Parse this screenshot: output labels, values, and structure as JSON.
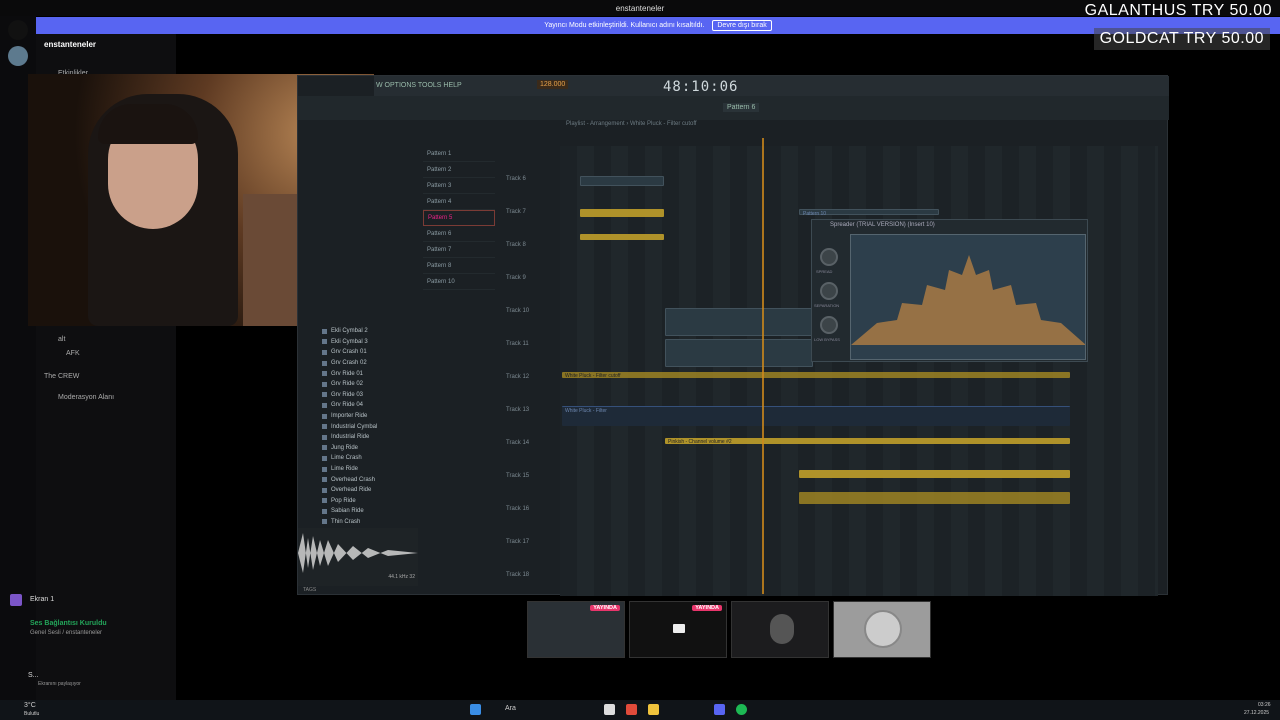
{
  "window": {
    "title": "enstanteneler"
  },
  "banner": {
    "text": "Yayıncı Modu etkinleştirildi. Kullanıcı adını kısaltıldı.",
    "button": "Devre dışı bırak"
  },
  "sidebar": {
    "server_name": "enstanteneler",
    "events": "Etkinlikler",
    "voice_user1": "alt",
    "voice_user2": "AFK",
    "group": "The CREW",
    "moderation": "Moderasyon Alanı"
  },
  "overlay": {
    "line1": "GALANTHUS TRY 50.00",
    "line2": "GOLDCAT TRY 50.00"
  },
  "daw": {
    "menu": "W OPTIONS TOOLS HELP",
    "time": "48:10:06",
    "tempo": "128.000",
    "pattern": "Pattern 6",
    "playlist_title": "Playlist - Arrangement › White Pluck - Filter cutoff",
    "patterns": [
      "Pattern 1",
      "Pattern 2",
      "Pattern 3",
      "Pattern 4",
      "Pattern 5",
      "Pattern 6",
      "Pattern 7",
      "Pattern 8",
      "Pattern 10"
    ],
    "browser": [
      "Ekli Cymbal 2",
      "Ekli Cymbal 3",
      "Grv Crash 01",
      "Grv Crash 02",
      "Grv Ride 01",
      "Grv Ride 02",
      "Grv Ride 03",
      "Grv Ride 04",
      "Importer Ride",
      "Industrial Cymbal",
      "Industrial Ride",
      "Jung Ride",
      "Lime Crash",
      "Lime Ride",
      "Overhead Crash",
      "Overhead Ride",
      "Pop Ride",
      "Sabian Ride",
      "Thin Crash"
    ],
    "tracks": [
      "Track 6",
      "Track 7",
      "Track 8",
      "Track 9",
      "Track 10",
      "Track 11",
      "Track 12",
      "Track 13",
      "Track 14",
      "Track 15",
      "Track 16",
      "Track 17",
      "Track 18"
    ],
    "plugin_title": "Spreader (TRIAL VERSION) (Insert 10)",
    "knob_labels": [
      "SPREAD",
      "SEPARATION",
      "LOW BYPASS"
    ],
    "clip_labels": {
      "pluck_filter": "White Pluck - Filter cutoff",
      "pluck": "White Pluck - Filter",
      "pinkish": "Pinkish - Channel volume #2",
      "pattern10": "Pattern 10"
    },
    "wave_footer": "44.1 kHz 32",
    "bottom_label": "TAGS"
  },
  "screens": [
    {
      "live": "YAYINDA"
    },
    {
      "live": "YAYINDA"
    }
  ],
  "bottom": {
    "screen_label": "Ekran 1",
    "voice_status": "Ses Bağlantısı Kuruldu",
    "voice_channel": "Genel Sesli / enstanteneler",
    "user_name": "S...",
    "user_status": "Ekranını paylaşıyor"
  },
  "taskbar": {
    "weather": "3°C",
    "weather_desc": "Bulutlu",
    "search": "Ara",
    "time": "03:26",
    "date": "27.12.2025"
  }
}
